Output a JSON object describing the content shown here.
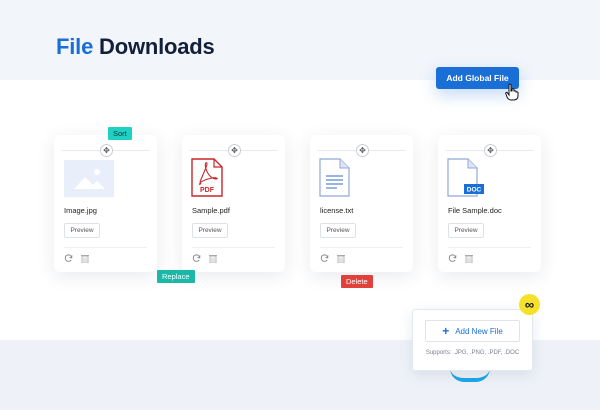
{
  "header": {
    "title_accent": "File",
    "title_rest": "Downloads"
  },
  "toolbar": {
    "add_global_label": "Add Global File"
  },
  "files": [
    {
      "name": "Image.jpg",
      "preview": "Preview",
      "type": "image"
    },
    {
      "name": "Sample.pdf",
      "preview": "Preview",
      "type": "pdf",
      "badge": "PDF"
    },
    {
      "name": "license.txt",
      "preview": "Preview",
      "type": "txt"
    },
    {
      "name": "File Sample.doc",
      "preview": "Preview",
      "type": "doc",
      "badge": "DOC"
    }
  ],
  "tags": {
    "sort": "Sort",
    "replace": "Replace",
    "delete": "Delete"
  },
  "add_panel": {
    "button_label": "Add New File",
    "supports": "Supports: .JPG, .PNG, .PDF, .DOC"
  },
  "colors": {
    "accent": "#1a6fd6",
    "sort_tag": "#1ed1c4",
    "replace_tag": "#1ab8a8",
    "delete_tag": "#e0413a",
    "pdf_red": "#c8262b",
    "badge_yellow": "#f5e12a"
  },
  "icons": {
    "sort_handle": "move-icon",
    "refresh": "refresh-icon",
    "trash": "trash-icon",
    "add": "plus-icon",
    "unlimited": "infinity-icon",
    "cursor": "hand-pointer-icon"
  }
}
